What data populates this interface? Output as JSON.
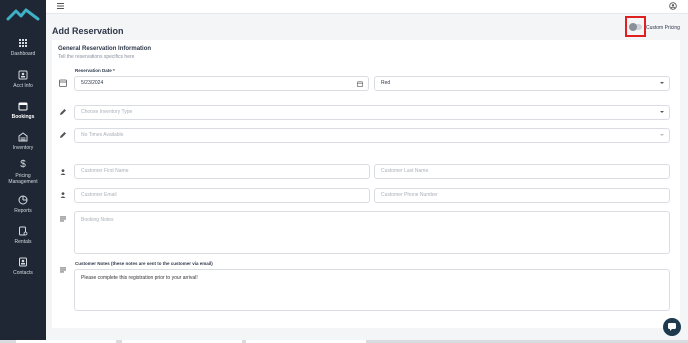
{
  "app": {
    "accent": "#3fb1c6",
    "sidebar_bg": "#1e2733",
    "highlight_color": "#e02020"
  },
  "sidebar": {
    "items": [
      {
        "label": "Dashboard",
        "icon": "grid-icon"
      },
      {
        "label": "Acct Info",
        "icon": "id-card-icon"
      },
      {
        "label": "Bookings",
        "icon": "calendar-icon"
      },
      {
        "label": "Inventory",
        "icon": "inventory-icon"
      },
      {
        "label": "Pricing",
        "label2": "Management",
        "icon": "dollar-icon"
      },
      {
        "label": "Reports",
        "icon": "reports-icon"
      },
      {
        "label": "Rentals",
        "icon": "rentals-icon"
      },
      {
        "label": "Contacts",
        "icon": "contacts-icon"
      }
    ]
  },
  "page": {
    "title": "Add Reservation"
  },
  "custom_pricing": {
    "label": "Custom Pricing",
    "enabled": false
  },
  "general": {
    "title": "General Reservation Information",
    "subtitle": "Tell the reservations specifics here"
  },
  "form": {
    "date_label": "Reservation Date *",
    "date_value": "5/23/2024",
    "day_value": "Red",
    "inventory_type_placeholder": "Choose Inventory Type",
    "times_placeholder": "No Times Available",
    "first_name_placeholder": "Customer First Name",
    "last_name_placeholder": "Customer Last Name",
    "email_placeholder": "Customer Email",
    "phone_placeholder": "Customer Phone Number",
    "booking_notes_placeholder": "Booking Notes",
    "customer_notes_label": "Customer Notes (these notes are sent to the customer via email)",
    "customer_notes_value": "Please complete this registration prior to your arrival!"
  }
}
